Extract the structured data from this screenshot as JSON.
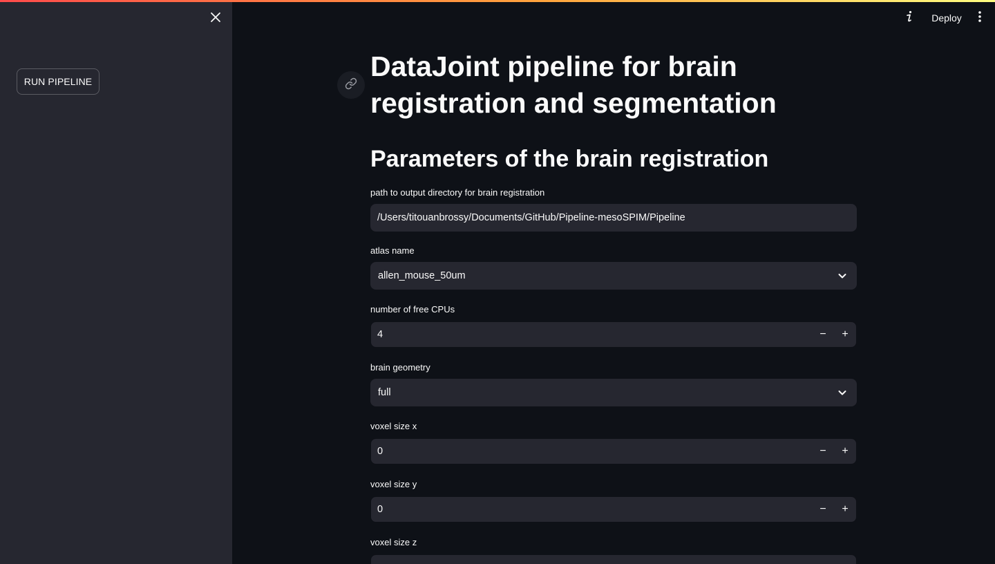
{
  "header": {
    "deploy_label": "Deploy"
  },
  "sidebar": {
    "run_button_label": "RUN PIPELINE"
  },
  "main": {
    "title": "DataJoint pipeline for brain registration and segmentation",
    "section_title": "Parameters of the brain registration",
    "fields": {
      "output_dir": {
        "label": "path to output directory for brain registration",
        "value": "/Users/titouanbrossy/Documents/GitHub/Pipeline-mesoSPIM/Pipeline"
      },
      "atlas_name": {
        "label": "atlas name",
        "value": "allen_mouse_50um"
      },
      "free_cpus": {
        "label": "number of free CPUs",
        "value": "4"
      },
      "brain_geometry": {
        "label": "brain geometry",
        "value": "full"
      },
      "voxel_x": {
        "label": "voxel size x",
        "value": "0"
      },
      "voxel_y": {
        "label": "voxel size y",
        "value": "0"
      },
      "voxel_z": {
        "label": "voxel size z",
        "value": ""
      }
    },
    "stepper": {
      "minus": "−",
      "plus": "+"
    }
  },
  "colors": {
    "background": "#0e1117",
    "sidebar": "#262730",
    "input": "#262730",
    "text": "#fafafa",
    "accent_start": "#ff4b4b",
    "accent_end": "#fffd80"
  },
  "icons": {
    "close": "close-icon",
    "info": "info-icon",
    "menu": "vertical-ellipsis-icon",
    "link": "link-icon",
    "chevron": "chevron-down-icon"
  }
}
